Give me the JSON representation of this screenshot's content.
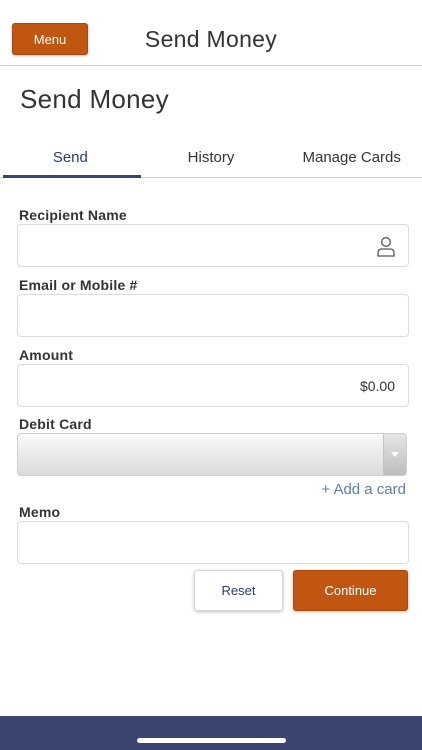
{
  "header": {
    "menu_label": "Menu",
    "title": "Send Money"
  },
  "page": {
    "title": "Send Money"
  },
  "tabs": [
    {
      "label": "Send",
      "active": true
    },
    {
      "label": "History",
      "active": false
    },
    {
      "label": "Manage Cards",
      "active": false
    }
  ],
  "form": {
    "recipient": {
      "label": "Recipient Name",
      "value": "",
      "icon": "person-icon"
    },
    "email": {
      "label": "Email or Mobile #",
      "value": ""
    },
    "amount": {
      "label": "Amount",
      "value": "$0.00"
    },
    "debit_card": {
      "label": "Debit Card",
      "selected": "",
      "icon": "chevron-down-icon"
    },
    "add_card_link": "+ Add a card",
    "memo": {
      "label": "Memo",
      "value": ""
    }
  },
  "actions": {
    "reset_label": "Reset",
    "continue_label": "Continue"
  },
  "colors": {
    "accent": "#c0560f",
    "navy": "#3a4670",
    "link": "#5b7fb2"
  }
}
